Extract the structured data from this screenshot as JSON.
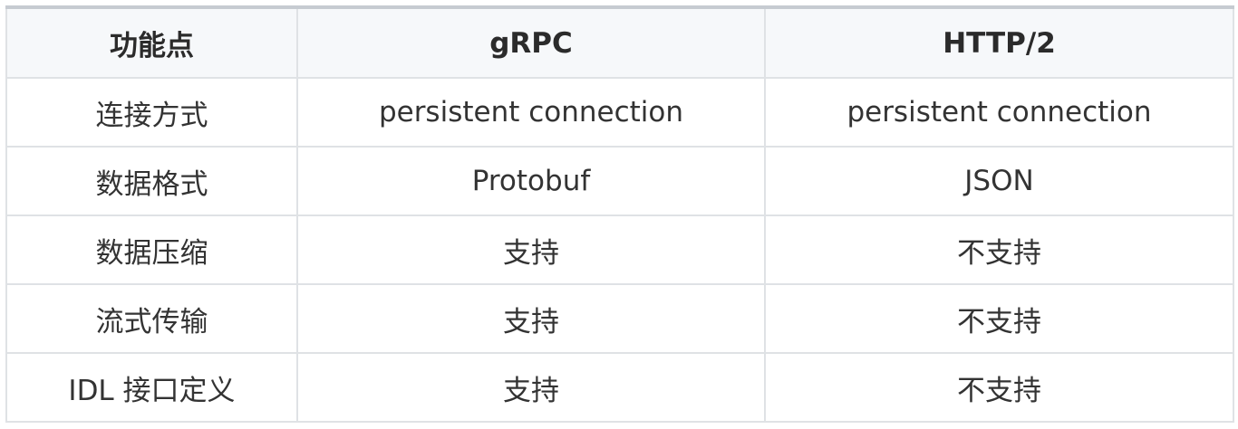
{
  "table": {
    "headers": [
      "功能点",
      "gRPC",
      "HTTP/2"
    ],
    "rows": [
      [
        "连接方式",
        "persistent connection",
        "persistent connection"
      ],
      [
        "数据格式",
        "Protobuf",
        "JSON"
      ],
      [
        "数据压缩",
        "支持",
        "不支持"
      ],
      [
        "流式传输",
        "支持",
        "不支持"
      ],
      [
        "IDL 接口定义",
        "支持",
        "不支持"
      ]
    ]
  },
  "colors": {
    "header_background": "#f6f8fa",
    "border": "#dfe2e5",
    "top_border": "#c6cbd1",
    "text": "#333333"
  }
}
